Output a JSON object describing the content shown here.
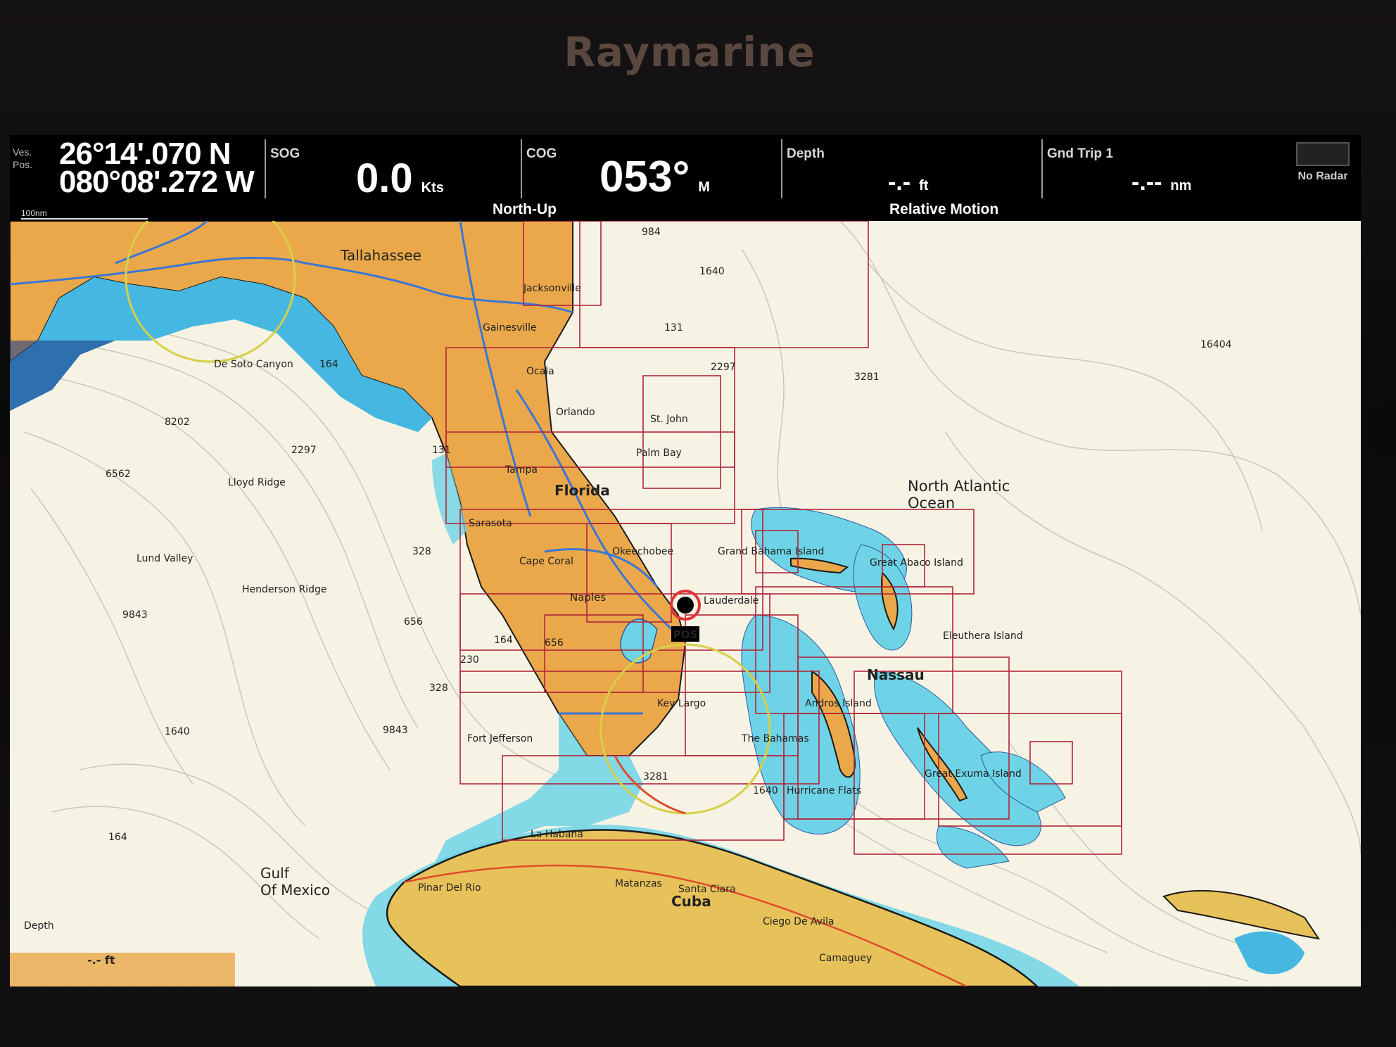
{
  "device": {
    "brand": "Raymarine"
  },
  "databar": {
    "vessel_position": {
      "label_top": "Ves.",
      "label_bottom": "Pos.",
      "lat": "26°14'.070 N",
      "lon": "080°08'.272 W"
    },
    "sog": {
      "label": "SOG",
      "value": "0.0",
      "unit": "Kts"
    },
    "cog": {
      "label": "COG",
      "value": "053°",
      "unit": "M"
    },
    "depth": {
      "label": "Depth",
      "value": "-.-",
      "unit": "ft"
    },
    "trip": {
      "label": "Gnd Trip 1",
      "value": "-.--",
      "unit": "nm"
    },
    "radar": {
      "label": "No Radar"
    },
    "scale": "100nm",
    "orientation": "North-Up",
    "motion_mode": "Relative Motion"
  },
  "chart": {
    "colors": {
      "land": "#eaa84a",
      "cuba": "#e7c25a",
      "shallow": "#6ed3e6",
      "deep_shallow": "#45b7e0",
      "water": "#f6f3e4",
      "chart_boxes": "#b2253a",
      "routes": "#3a76d6",
      "range_ring": "#d8cf46"
    },
    "labels": {
      "tallahassee": "Tallahassee",
      "jacksonville": "Jacksonville",
      "gainesville": "Gainesville",
      "ocala": "Ocala",
      "orlando": "Orlando",
      "cape_canaveral": "St. John",
      "palm_bay": "Palm Bay",
      "tampa": "Tampa",
      "florida": "Florida",
      "sarasota": "Sarasota",
      "okeechobee": "Okeechobee",
      "cape_coral": "Cape Coral",
      "naples": "Naples",
      "lauderdale": "Lauderdale",
      "key_largo": "Key Largo",
      "fort_jefferson": "Fort Jefferson",
      "grand_bahama": "Grand Bahama Island",
      "great_abaco": "Great Abaco Island",
      "nassau": "Nassau",
      "eleuthera": "Eleuthera Island",
      "andros": "Andros Island",
      "bahamas": "The Bahamas",
      "hurricane_flats": "Hurricane Flats",
      "great_exuma": "Great Exuma Island",
      "north_atlantic": "North Atlantic",
      "ocean": "Ocean",
      "desoto": "De Soto Canyon",
      "lloyd_ridge": "Lloyd Ridge",
      "lund_valley": "Lund Valley",
      "henderson_ridge": "Henderson Ridge",
      "gulf": "Gulf",
      "of_mexico": "Of Mexico",
      "havana": "La Habana",
      "pinar": "Pinar Del Rio",
      "matanzas": "Matanzas",
      "santa_clara": "Santa Clara",
      "cuba": "Cuba",
      "ciego": "Ciego De Avila",
      "camaguey": "Camaguey",
      "pos": "POS",
      "depth_corner": "Depth",
      "depth_corner_value": "-.- ft"
    },
    "soundings": [
      "984",
      "1640",
      "131",
      "2297",
      "3281",
      "16404",
      "164",
      "8202",
      "6562",
      "2297",
      "131",
      "328",
      "656",
      "9843",
      "1640",
      "9843",
      "328",
      "656",
      "164",
      "230",
      "3281",
      "1640",
      "164"
    ]
  }
}
